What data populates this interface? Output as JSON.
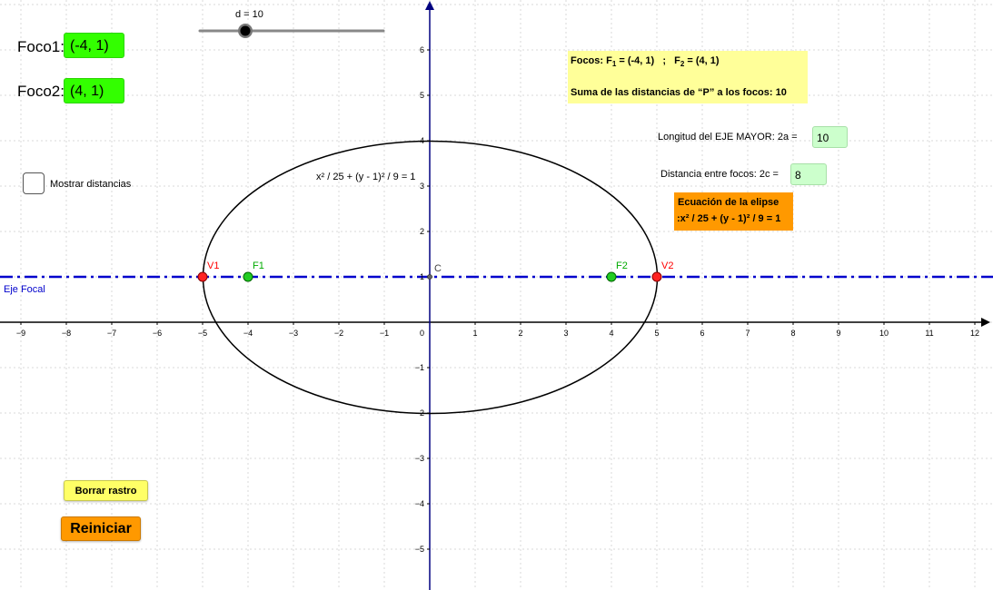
{
  "slider": {
    "label": "d = 10",
    "min": 0,
    "max": 30,
    "value": 10
  },
  "foco1": {
    "label": "Foco1:",
    "value": "(-4, 1)"
  },
  "foco2": {
    "label": "Foco2:",
    "value": "(4, 1)"
  },
  "checkbox": {
    "label": "Mostrar distancias",
    "checked": false
  },
  "info": {
    "line1_prefix": "Focos: F",
    "f1_sub": "1",
    "f1_value": " = (-4, 1)   ;   F",
    "f2_sub": "2",
    "f2_value": " = (4, 1)",
    "line2": "Suma de las distancias de “P” a los focos: 10"
  },
  "eje_mayor": {
    "label": "Longitud del EJE MAYOR: 2a =",
    "value": "10"
  },
  "dist_focos": {
    "label": "Distancia entre focos: 2c =",
    "value": "8"
  },
  "ecuacion_box": {
    "title": "Ecuación de la elipse",
    "formula": ":x² / 25 + (y - 1)² / 9 = 1"
  },
  "graph": {
    "x_ticks": [
      "−9",
      "−8",
      "−7",
      "−6",
      "−5",
      "−4",
      "−3",
      "−2",
      "−1",
      "0",
      "1",
      "2",
      "3",
      "4",
      "5",
      "6",
      "7",
      "8",
      "9",
      "10",
      "11",
      "12"
    ],
    "y_ticks": [
      "6",
      "5",
      "4",
      "3",
      "2",
      "1",
      "−1",
      "−2",
      "−3",
      "−4",
      "−5"
    ],
    "ellipse_label": "x² / 25 + (y - 1)² / 9 = 1",
    "eje_focal_label": "Eje Focal",
    "points": {
      "V1": "V1",
      "V2": "V2",
      "F1": "F1",
      "F2": "F2",
      "C": "C"
    },
    "colors": {
      "axis": "#000000",
      "focal_line": "#0000cc",
      "focus": "#00aa00",
      "vertex": "#ff0000",
      "ellipse": "#000000"
    }
  },
  "buttons": {
    "borrar": "Borrar rastro",
    "reiniciar": "Reiniciar"
  }
}
